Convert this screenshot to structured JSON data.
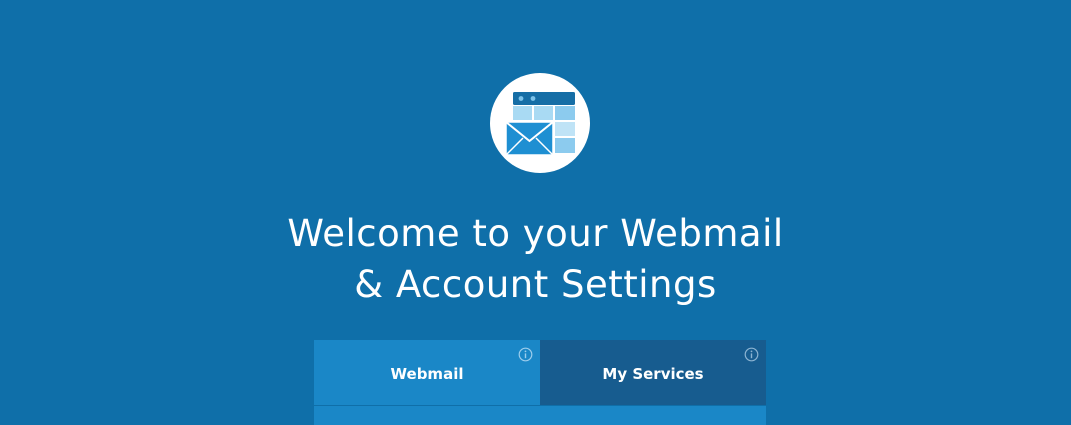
{
  "header": {
    "logo_icon": "webmail-envelope-icon",
    "title_line1": "Welcome to your Webmail",
    "title_line2": "& Account Settings"
  },
  "tabs": [
    {
      "label": "Webmail",
      "active": true,
      "info_icon": "info-icon"
    },
    {
      "label": "My Services",
      "active": false,
      "info_icon": "info-icon"
    }
  ],
  "colors": {
    "background": "#0f6fa9",
    "active_tab": "#1a87c7",
    "inactive_tab": "#175c8f",
    "text": "#ffffff"
  }
}
